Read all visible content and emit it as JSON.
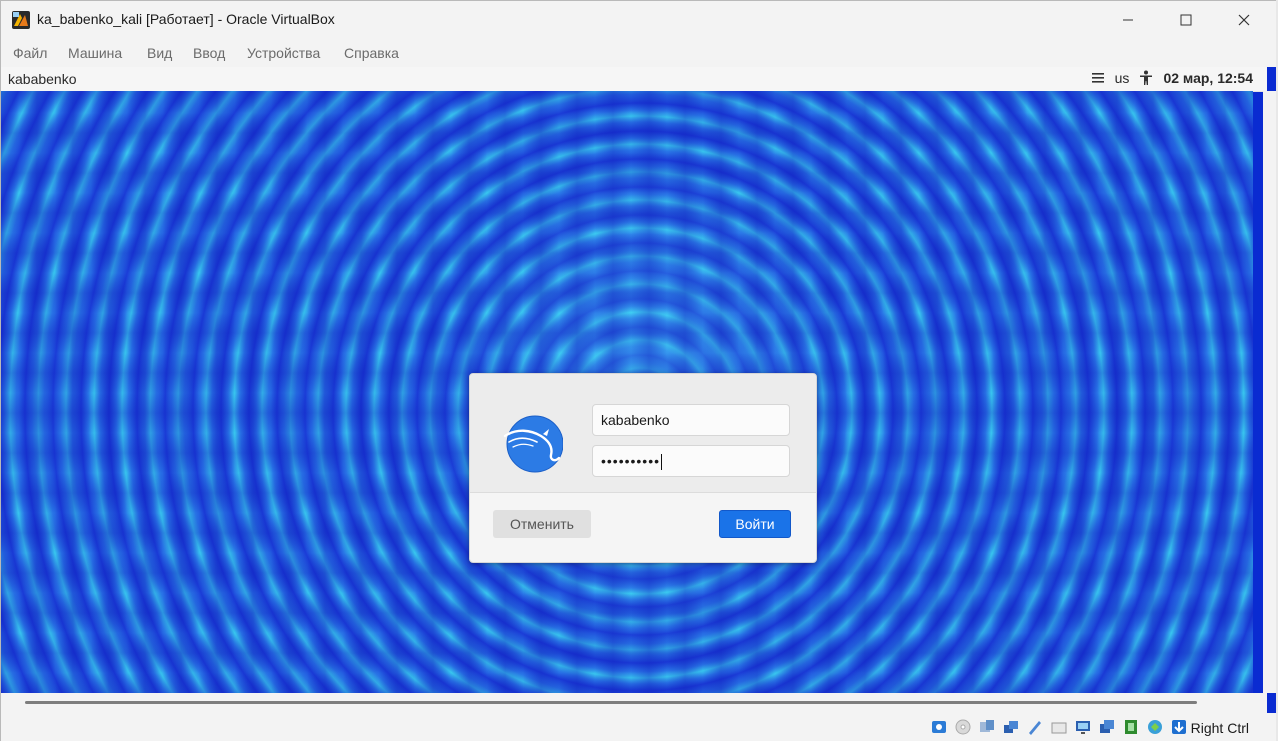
{
  "window": {
    "title": "ka_babenko_kali [Работает] - Oracle VirtualBox",
    "controls": [
      "minimize-icon",
      "maximize-icon",
      "close-icon"
    ]
  },
  "menu": {
    "items": [
      "Файл",
      "Машина",
      "Вид",
      "Ввод",
      "Устройства",
      "Справка"
    ]
  },
  "guest": {
    "top_bar": {
      "hostname": "kababenko",
      "keyboard_layout": "us",
      "datetime": "02 мар, 12:54"
    },
    "login_dialog": {
      "username": "kababenko",
      "password_mask": "••••••••••",
      "cancel_label": "Отменить",
      "login_label": "Войти",
      "accent_color": "#1a73e8"
    }
  },
  "statusbar": {
    "icons": [
      "hard-disk-icon",
      "optical-disc-icon",
      "audio-icon",
      "network-icon",
      "usb-icon",
      "shared-folders-icon",
      "display-icon",
      "capture-icon",
      "cpu-icon",
      "mouse-integration-icon",
      "keyboard-icon"
    ],
    "host_key": "Right Ctrl"
  }
}
